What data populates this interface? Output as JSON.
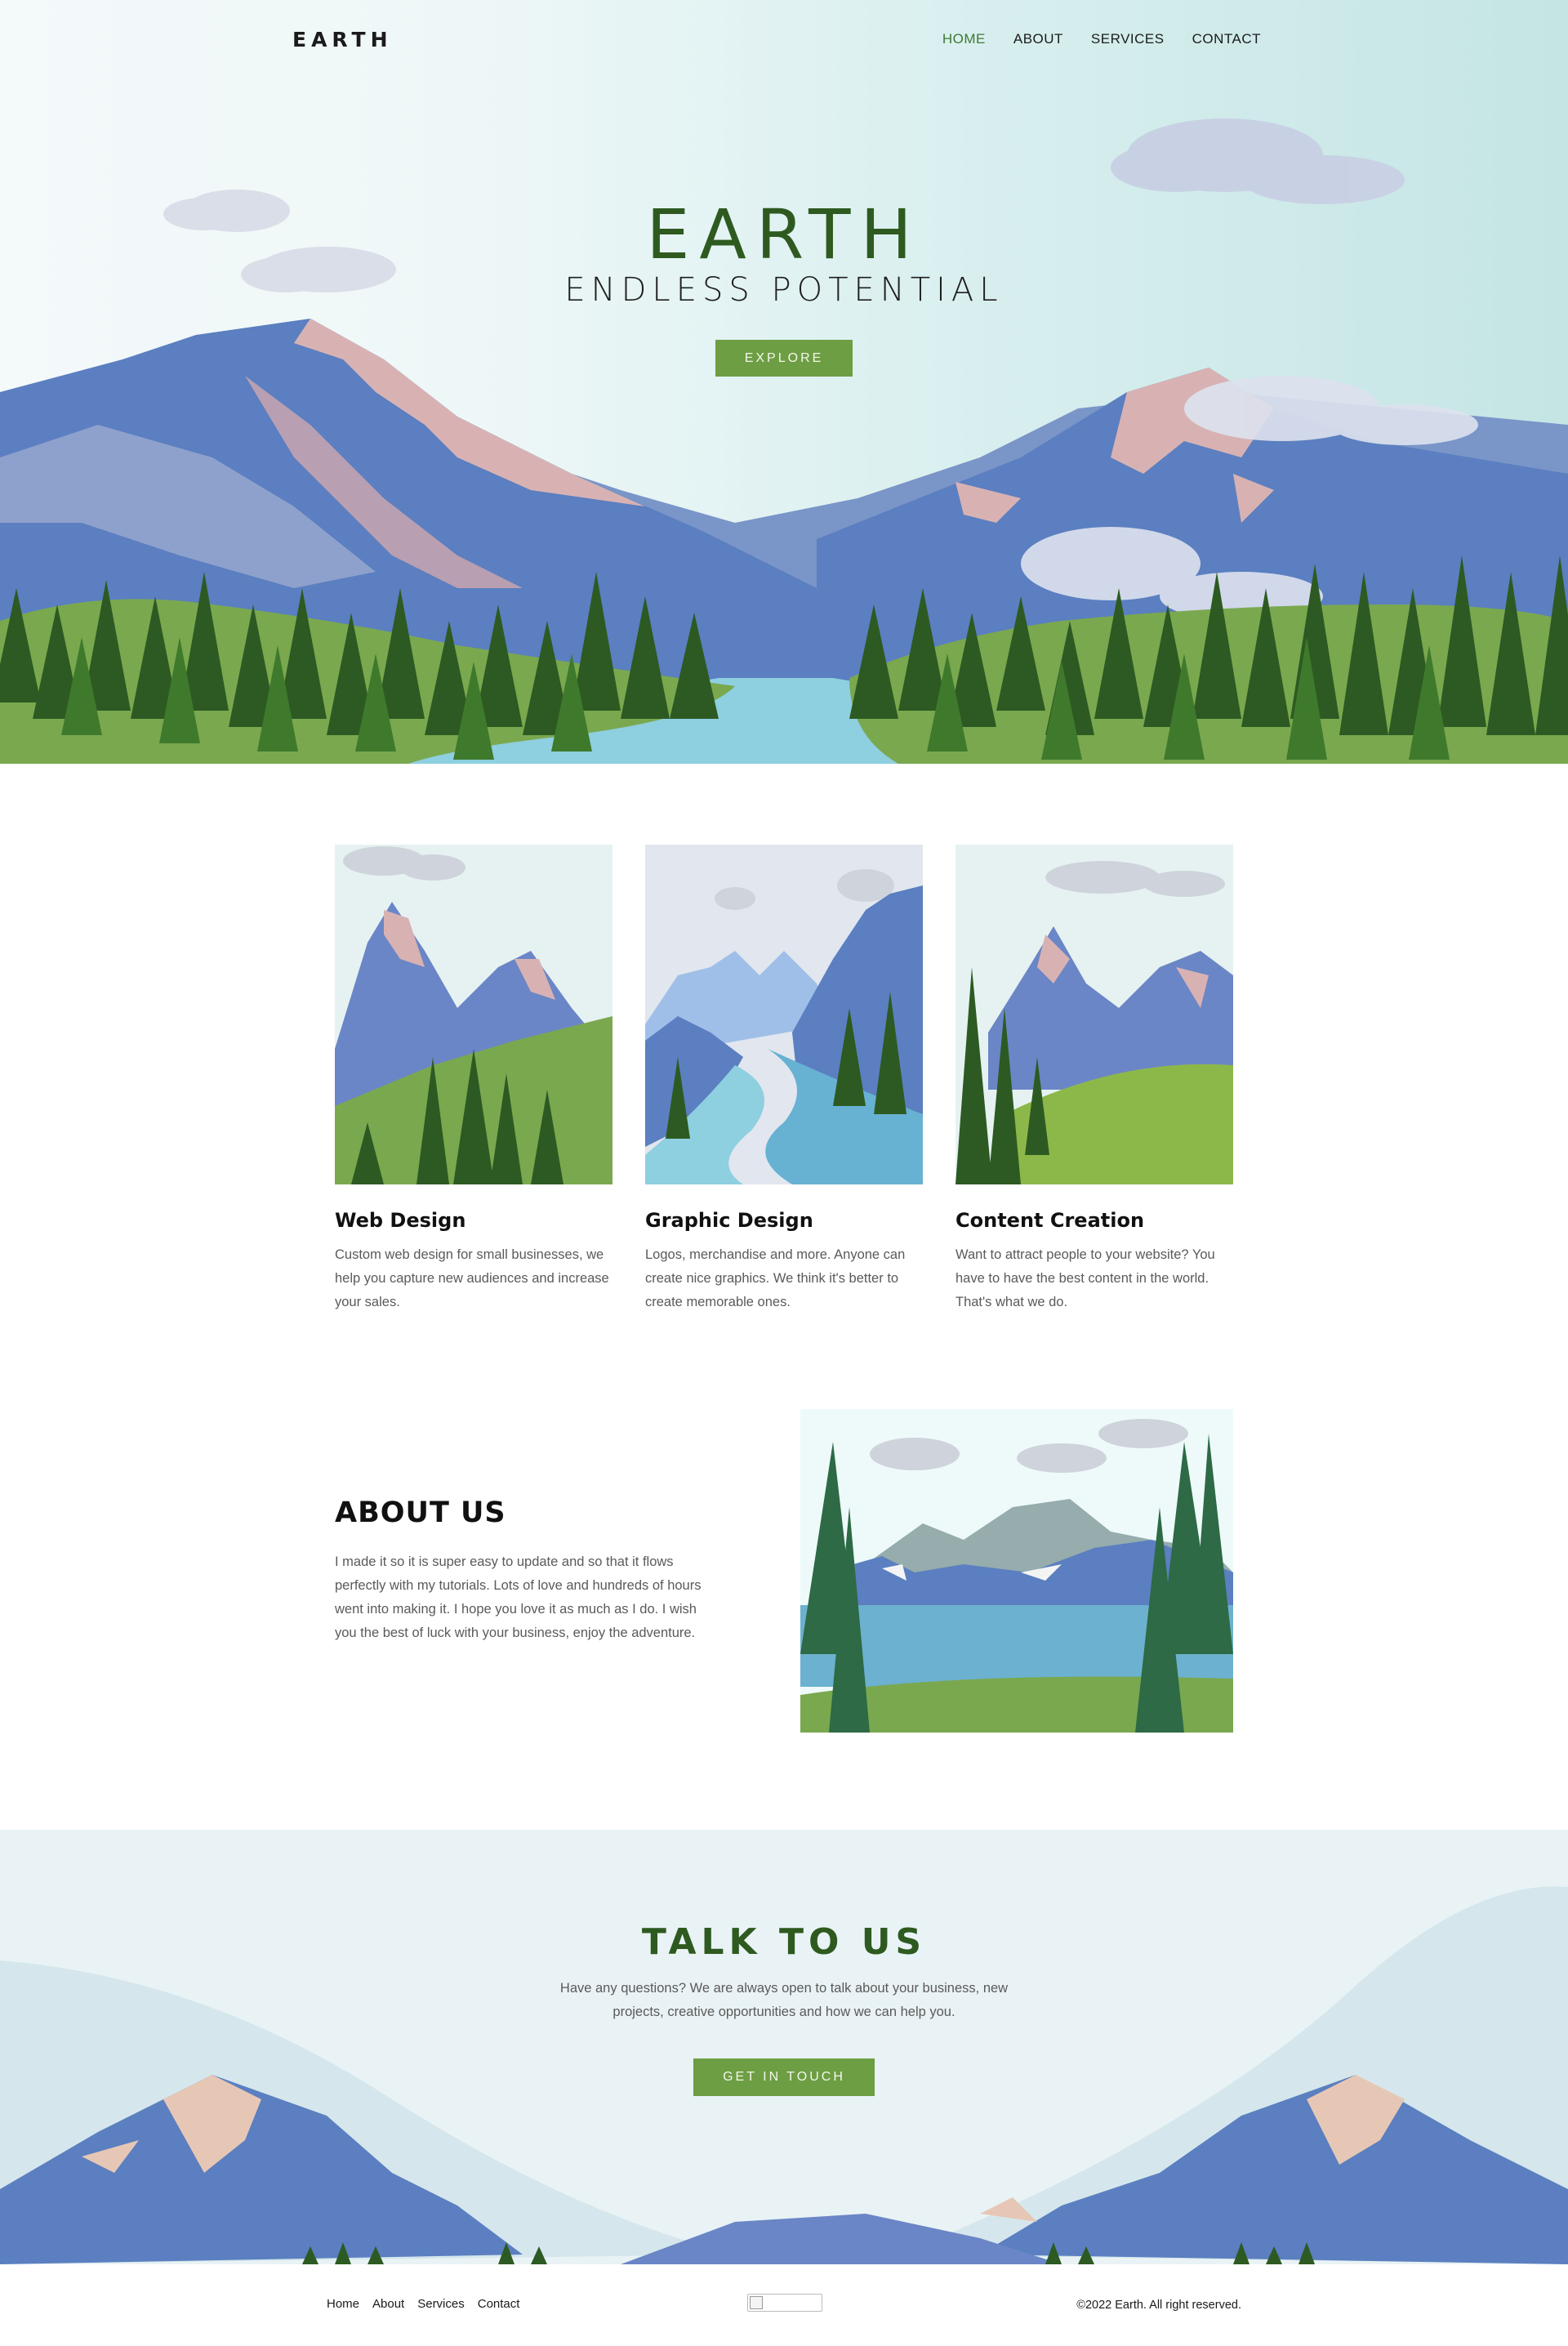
{
  "nav": {
    "logo": "EARTH",
    "links": [
      "HOME",
      "ABOUT",
      "SERVICES",
      "CONTACT"
    ],
    "active": "HOME"
  },
  "hero": {
    "title": "EARTH",
    "subtitle": "ENDLESS POTENTIAL",
    "button": "EXPLORE"
  },
  "services": [
    {
      "title": "Web Design",
      "text": "Custom web design for small businesses, we help you capture new audiences and increase your sales."
    },
    {
      "title": "Graphic Design",
      "text": "Logos, merchandise and more. Anyone can create nice graphics. We think it's better to create memorable ones."
    },
    {
      "title": "Content Creation",
      "text": "Want to attract people to your website? You have to have the best content in the world. That's what we do."
    }
  ],
  "about": {
    "title": "ABOUT US",
    "text": "I made it so it is super easy to update and so that it flows perfectly with my tutorials. Lots of love and hundreds of hours went into making it. I hope you love it as much as I do. I wish you the best of luck with your business, enjoy the adventure."
  },
  "talk": {
    "title": "TALK TO US",
    "text": "Have any questions? We are always open to talk about your business, new projects, creative opportunities and how we can help you.",
    "button": "GET IN TOUCH"
  },
  "footer": {
    "links": [
      "Home",
      "About",
      "Services",
      "Contact"
    ],
    "copyright": "©2022 Earth. All right reserved."
  },
  "colors": {
    "accent_green": "#6e9e43",
    "title_green": "#2e5a20",
    "mountain_blue": "#5b7fc0",
    "sky_teal": "#c4e5e4"
  }
}
